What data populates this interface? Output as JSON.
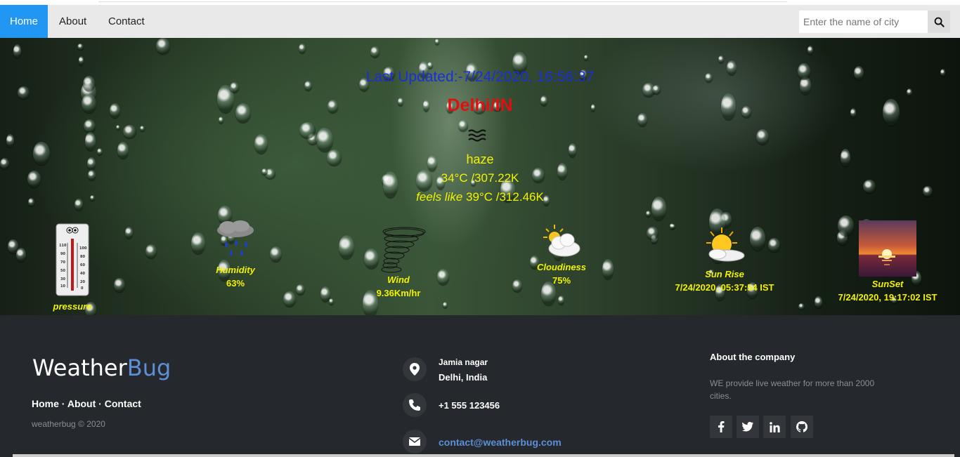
{
  "nav": {
    "items": [
      {
        "label": "Home",
        "active": true
      },
      {
        "label": "About",
        "active": false
      },
      {
        "label": "Contact",
        "active": false
      }
    ],
    "search_placeholder": "Enter the name of city"
  },
  "weather": {
    "last_updated": "Last Updated:-7/24/2020, 16:56:37",
    "location": "Delhi/IN",
    "description": "haze",
    "temperature": "34°C /307.22K",
    "feels_like_label": "feels like",
    "feels_like_value": "39°C /312.46K",
    "stats": {
      "pressure_label": "pressure",
      "humidity_label": "Humidity",
      "humidity_value": "63%",
      "wind_label": "Wind",
      "wind_value": "9.36Km/hr",
      "cloudiness_label": "Cloudiness",
      "cloudiness_value": "75%",
      "sunrise_label": "Sun Rise",
      "sunrise_value": "7/24/2020, 05:37:54 IST",
      "sunset_label": "SunSet",
      "sunset_value": "7/24/2020, 19:17:02 IST"
    }
  },
  "footer": {
    "brand_main": "Weather",
    "brand_accent": "Bug",
    "links": [
      "Home",
      "About",
      "Contact"
    ],
    "link_separator": " · ",
    "copyright": "weatherbug © 2020",
    "address_line1": "Jamia nagar",
    "address_line2": "Delhi, India",
    "phone": "+1 555 123456",
    "email": "contact@weatherbug.com",
    "about_heading": "About the company",
    "about_text": "WE provide live weather for more than 2000 cities.",
    "social": [
      "facebook-icon",
      "twitter-icon",
      "linkedin-icon",
      "github-icon"
    ]
  },
  "colors": {
    "nav_active": "#2196f3",
    "last_updated": "#1a2fd8",
    "location": "#e01010",
    "weather_text": "#f2f200",
    "footer_bg": "#25282c",
    "brand_accent": "#5c8fd6"
  }
}
